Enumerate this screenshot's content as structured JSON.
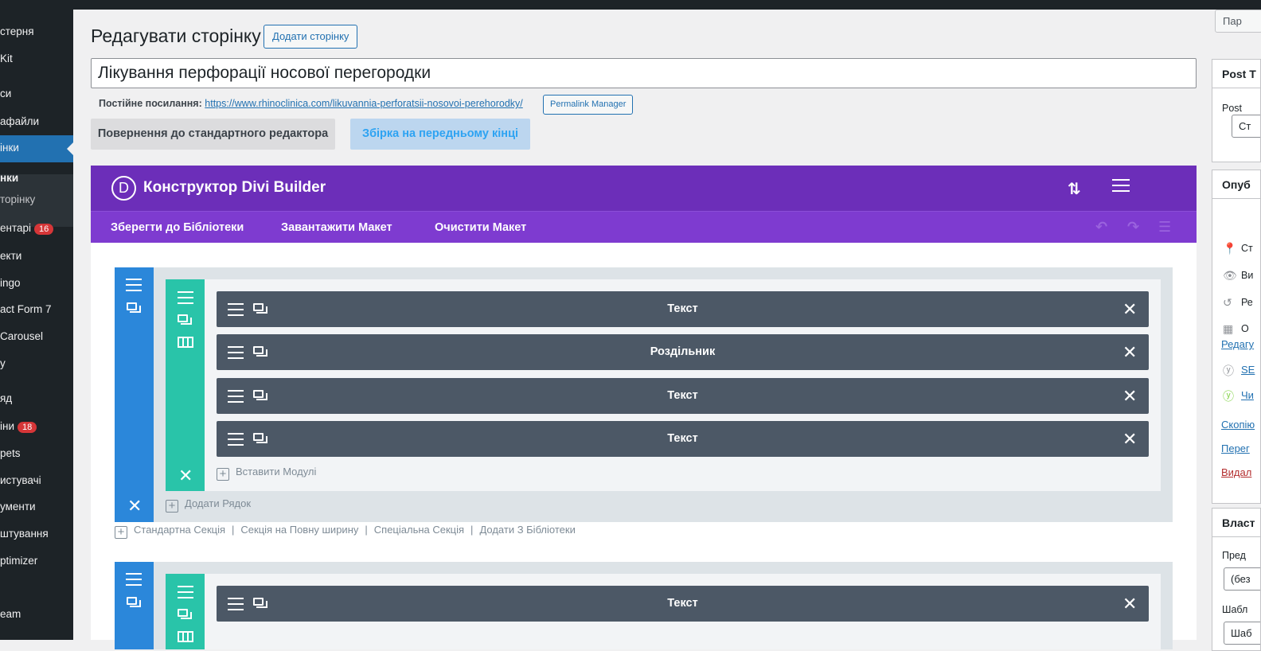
{
  "sidebar": {
    "items": [
      {
        "label": "стерня"
      },
      {
        "label": "Kit"
      },
      {
        "label": "си"
      },
      {
        "label": "афайли"
      },
      {
        "label": "інки"
      },
      {
        "label": "нки"
      },
      {
        "label": "торінку"
      },
      {
        "label": "ентарі",
        "badge": "16"
      },
      {
        "label": "екти"
      },
      {
        "label": "ingo"
      },
      {
        "label": "act Form 7"
      },
      {
        "label": "Carousel"
      },
      {
        "label": "у"
      },
      {
        "label": "яд"
      },
      {
        "label": "іни",
        "badge": "18"
      },
      {
        "label": "pets"
      },
      {
        "label": "истувачі"
      },
      {
        "label": "ументи"
      },
      {
        "label": "штування"
      },
      {
        "label": "ptimizer"
      },
      {
        "label": "eam"
      }
    ]
  },
  "header": {
    "title": "Редагувати сторінку",
    "add_page_label": "Додати сторінку"
  },
  "post": {
    "title_value": "Лікування перфорації носової перегородки",
    "permalink_label": "Постійне посилання:",
    "permalink_url": "https://www.rhinoclinica.com/likuvannia-perforatsii-nosovoi-perehorodky/",
    "permalink_manager_label": "Permalink Manager"
  },
  "editor_buttons": {
    "standard_editor": "Повернення до стандартного редактора",
    "frontend_builder": "Збірка на передньому кінці"
  },
  "divi": {
    "logo_letter": "D",
    "title": "Конструктор Divi Builder",
    "sort_icon": "⇅",
    "toolbar": {
      "save_library": "Зберегти до Бібліотеки",
      "load_layout": "Завантажити Макет",
      "clear_layout": "Очистити Макет"
    },
    "sections": [
      {
        "modules": [
          "Текст",
          "Роздільник",
          "Текст",
          "Текст"
        ],
        "insert_modules": "Вставити Модулі",
        "add_row": "Додати Рядок"
      },
      {
        "modules": [
          "Текст"
        ]
      }
    ],
    "section_links": {
      "standard": "Стандартна Секція",
      "fullwidth": "Секція на Повну ширину",
      "special": "Спеціальна Секція",
      "from_library": "Додати З Бібліотеки",
      "separator": "|"
    }
  },
  "right_column": {
    "preview_label": "Пар",
    "box1_title": "Post T",
    "box1_label": "Post",
    "box1_select": "Ст",
    "box2_title": "Опуб",
    "status_rows": [
      "Ст",
      "Ви",
      "Ре",
      "О"
    ],
    "edit_link": "Редагу",
    "seo_link": "SE",
    "readability_link": "Чи",
    "copy_link": "Скопію",
    "move_link": "Перег",
    "delete_link": "Видал",
    "box3_title": "Власт",
    "parent_label": "Пред",
    "parent_select": "(без",
    "template_label": "Шабл",
    "template_select": "Шаб"
  },
  "colors": {
    "wp_sidebar": "#1d2327",
    "wp_blue": "#2271b1",
    "divi_purple": "#6c2eb9",
    "divi_toolbar": "#7e3bd0",
    "section_blue": "#2b87da",
    "row_teal": "#29c4a9",
    "module_gray": "#4c5866"
  }
}
